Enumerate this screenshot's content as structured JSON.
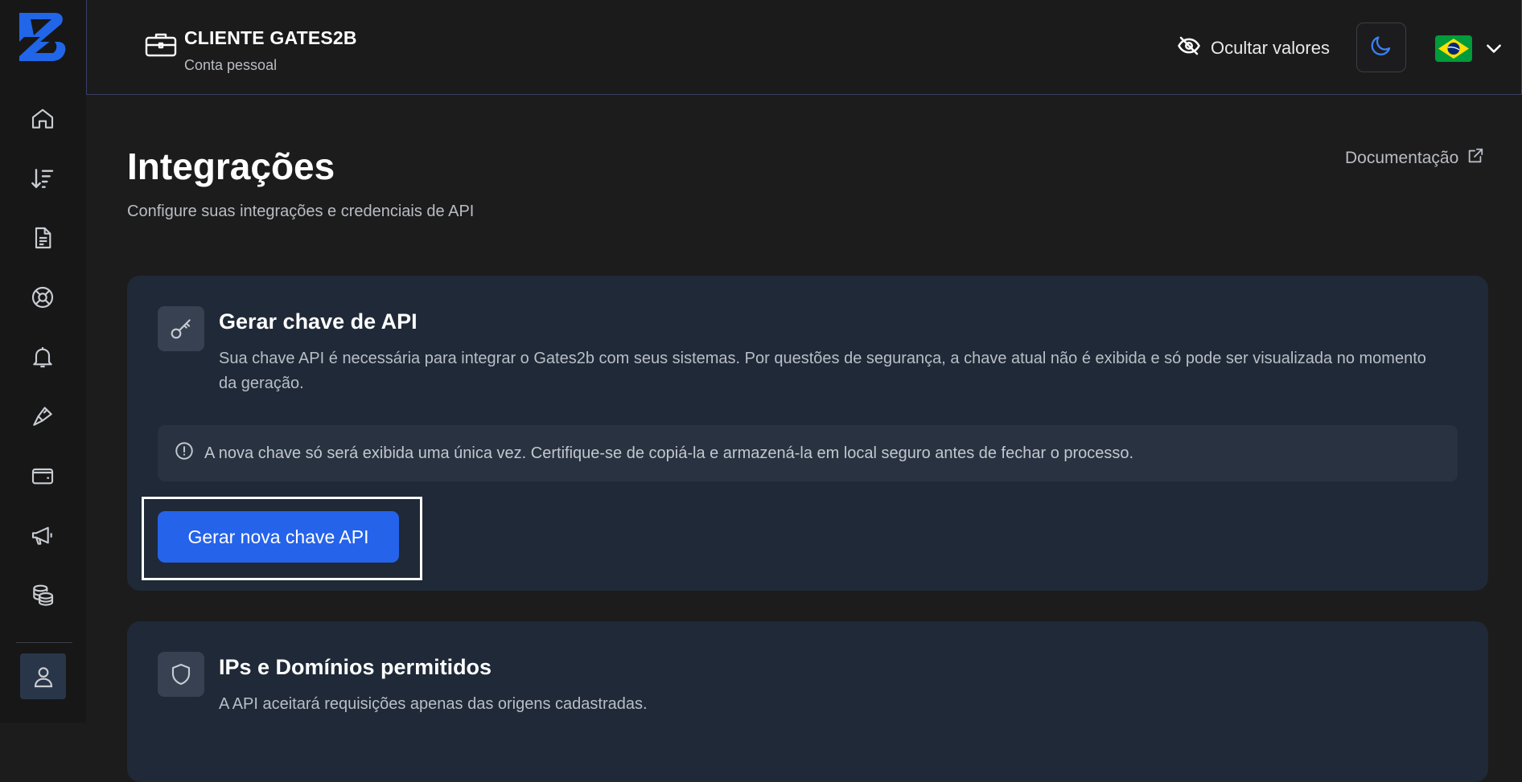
{
  "colors": {
    "accent": "#2563eb",
    "card_bg": "#1f2937",
    "page_bg": "#1c1c1d",
    "sidebar_bg": "#171717",
    "flag_green": "#009b3a",
    "flag_yellow": "#fedf00",
    "flag_blue": "#002776"
  },
  "sidebar": {
    "logo": "gates2b-logo",
    "items": [
      {
        "icon": "home-icon"
      },
      {
        "icon": "sort-transactions-icon"
      },
      {
        "icon": "document-icon"
      },
      {
        "icon": "integrations-icon"
      },
      {
        "icon": "bell-icon"
      },
      {
        "icon": "brush-icon"
      },
      {
        "icon": "wallet-icon"
      },
      {
        "icon": "megaphone-icon"
      },
      {
        "icon": "coins-icon"
      }
    ],
    "user_icon": "user-icon"
  },
  "header": {
    "client_name": "CLIENTE GATES2B",
    "client_subtitle": "Conta pessoal",
    "hide_values_label": "Ocultar valores",
    "theme_icon": "moon-icon",
    "language_flag": "brazil-flag"
  },
  "page": {
    "title": "Integrações",
    "subtitle": "Configure suas integrações e credenciais de API",
    "doc_link": "Documentação"
  },
  "api_key_card": {
    "icon": "key-icon",
    "title": "Gerar chave de API",
    "description": "Sua chave API é necessária para integrar o Gates2b com seus sistemas. Por questões de segurança, a chave atual não é exibida e só pode ser visualizada no momento da geração.",
    "alert_text": "A nova chave só será exibida uma única vez. Certifique-se de copiá-la e armazená-la em local seguro antes de fechar o processo.",
    "button_label": "Gerar nova chave API"
  },
  "ips_card": {
    "icon": "shield-icon",
    "title": "IPs e Domínios permitidos",
    "description": "A API aceitará requisições apenas das origens cadastradas."
  }
}
